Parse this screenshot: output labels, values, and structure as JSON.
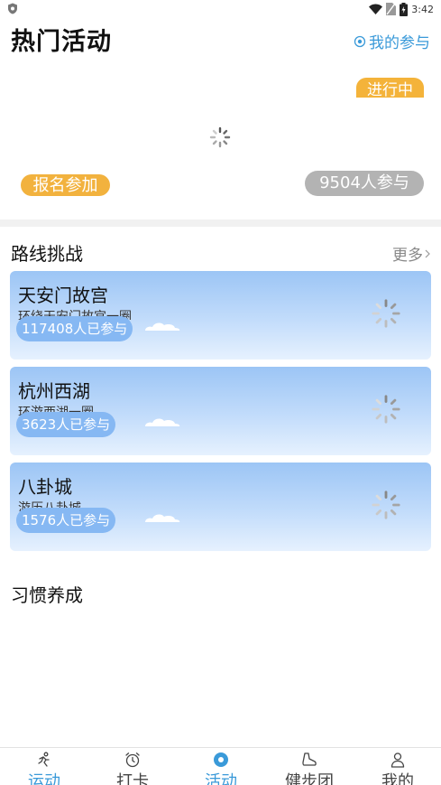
{
  "status_bar": {
    "time": "3:42"
  },
  "header": {
    "title": "热门活动",
    "my_join_label": "我的参与"
  },
  "hot_event": {
    "status_badge": "进行中",
    "signup_label": "报名参加",
    "participants": "9504人参与"
  },
  "route_section": {
    "title": "路线挑战",
    "more_label": "更多",
    "routes": [
      {
        "name": "天安门故宫",
        "desc": "环绕天安门故宫一圈",
        "count": "117408人已参与"
      },
      {
        "name": "杭州西湖",
        "desc": "环游西湖一圈",
        "count": "3623人已参与"
      },
      {
        "name": "八卦城",
        "desc": "游历八卦城",
        "count": "1576人已参与"
      }
    ]
  },
  "habit_section": {
    "title": "习惯养成"
  },
  "bottom_nav": {
    "items": [
      {
        "label": "运动",
        "icon": "run-icon"
      },
      {
        "label": "打卡",
        "icon": "alarm-clock-icon"
      },
      {
        "label": "活动",
        "icon": "activity-icon",
        "active": true
      },
      {
        "label": "健步团",
        "icon": "shoe-icon"
      },
      {
        "label": "我的",
        "icon": "person-icon"
      }
    ]
  },
  "colors": {
    "accent": "#3a9ad9",
    "badge_orange": "#f4b33a",
    "card_blue": "#9cc5f5",
    "pill_gray": "#b3b3b3"
  }
}
